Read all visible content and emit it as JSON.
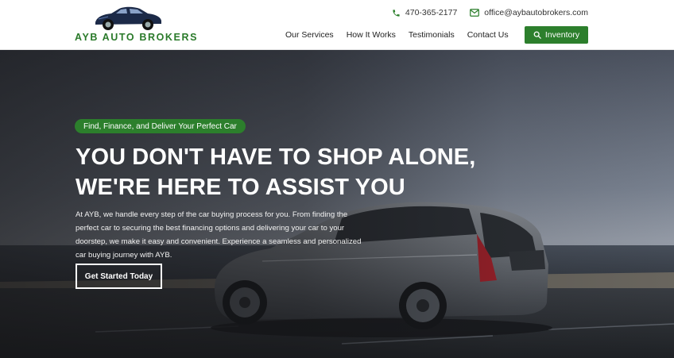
{
  "brand": {
    "name": "AYB AUTO BROKERS",
    "color": "#2c7f2c"
  },
  "contact": {
    "phone": "470-365-2177",
    "phone_icon": "phone-icon",
    "email": "office@aybautobrokers.com",
    "email_icon": "mail-icon"
  },
  "nav": {
    "items": [
      {
        "label": "Our Services"
      },
      {
        "label": "How It Works"
      },
      {
        "label": "Testimonials"
      },
      {
        "label": "Contact Us"
      }
    ],
    "inventory_label": "Inventory",
    "inventory_icon": "search-icon"
  },
  "hero": {
    "tag": "Find, Finance, and Deliver Your Perfect Car",
    "headline_line1": "YOU DON'T HAVE TO SHOP ALONE,",
    "headline_line2": "WE'RE HERE TO ASSIST YOU",
    "description": "At AYB, we handle every step of the car buying process for you. From finding the perfect car to securing the best financing options and delivering your car to your doorstep, we make it easy and convenient. Experience a seamless and personalized car buying journey with AYB.",
    "cta_label": "Get Started Today"
  }
}
